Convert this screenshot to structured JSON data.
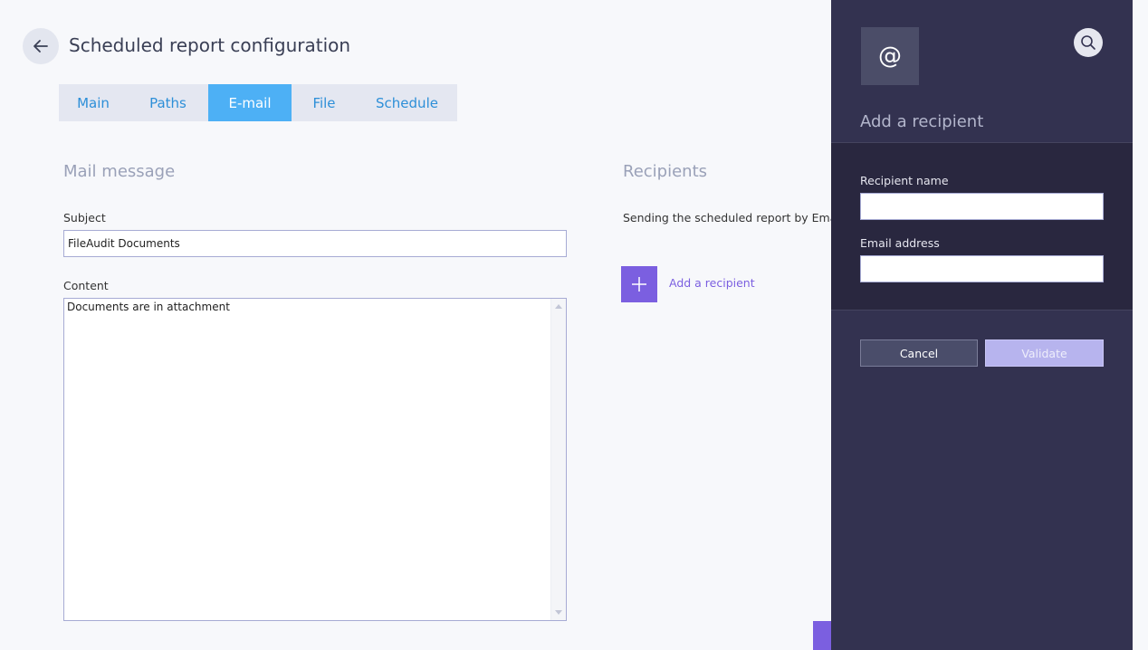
{
  "header": {
    "back_icon": "arrow-left-icon",
    "title": "Scheduled report configuration"
  },
  "tabs": [
    {
      "label": "Main",
      "active": false
    },
    {
      "label": "Paths",
      "active": false
    },
    {
      "label": "E-mail",
      "active": true
    },
    {
      "label": "File",
      "active": false
    },
    {
      "label": "Schedule",
      "active": false
    }
  ],
  "mail_message": {
    "section_title": "Mail message",
    "subject_label": "Subject",
    "subject_value": "FileAudit Documents",
    "content_label": "Content",
    "content_value": "Documents are in attachment"
  },
  "recipients": {
    "section_title": "Recipients",
    "description": "Sending the scheduled report by Email",
    "add_icon": "plus-icon",
    "add_label": "Add a recipient"
  },
  "panel": {
    "icon": "at-sign-icon",
    "icon_glyph": "@",
    "search_icon": "search-icon",
    "title": "Add a recipient",
    "name_label": "Recipient name",
    "name_value": "",
    "email_label": "Email address",
    "email_value": "",
    "cancel_label": "Cancel",
    "validate_label": "Validate"
  },
  "colors": {
    "accent": "#7b5fe0",
    "tab_active": "#4db0f5",
    "tab_text": "#2d8fd8",
    "panel_bg": "#333250",
    "panel_form_bg": "#29273f",
    "validate_bg": "#b7b4ee"
  }
}
